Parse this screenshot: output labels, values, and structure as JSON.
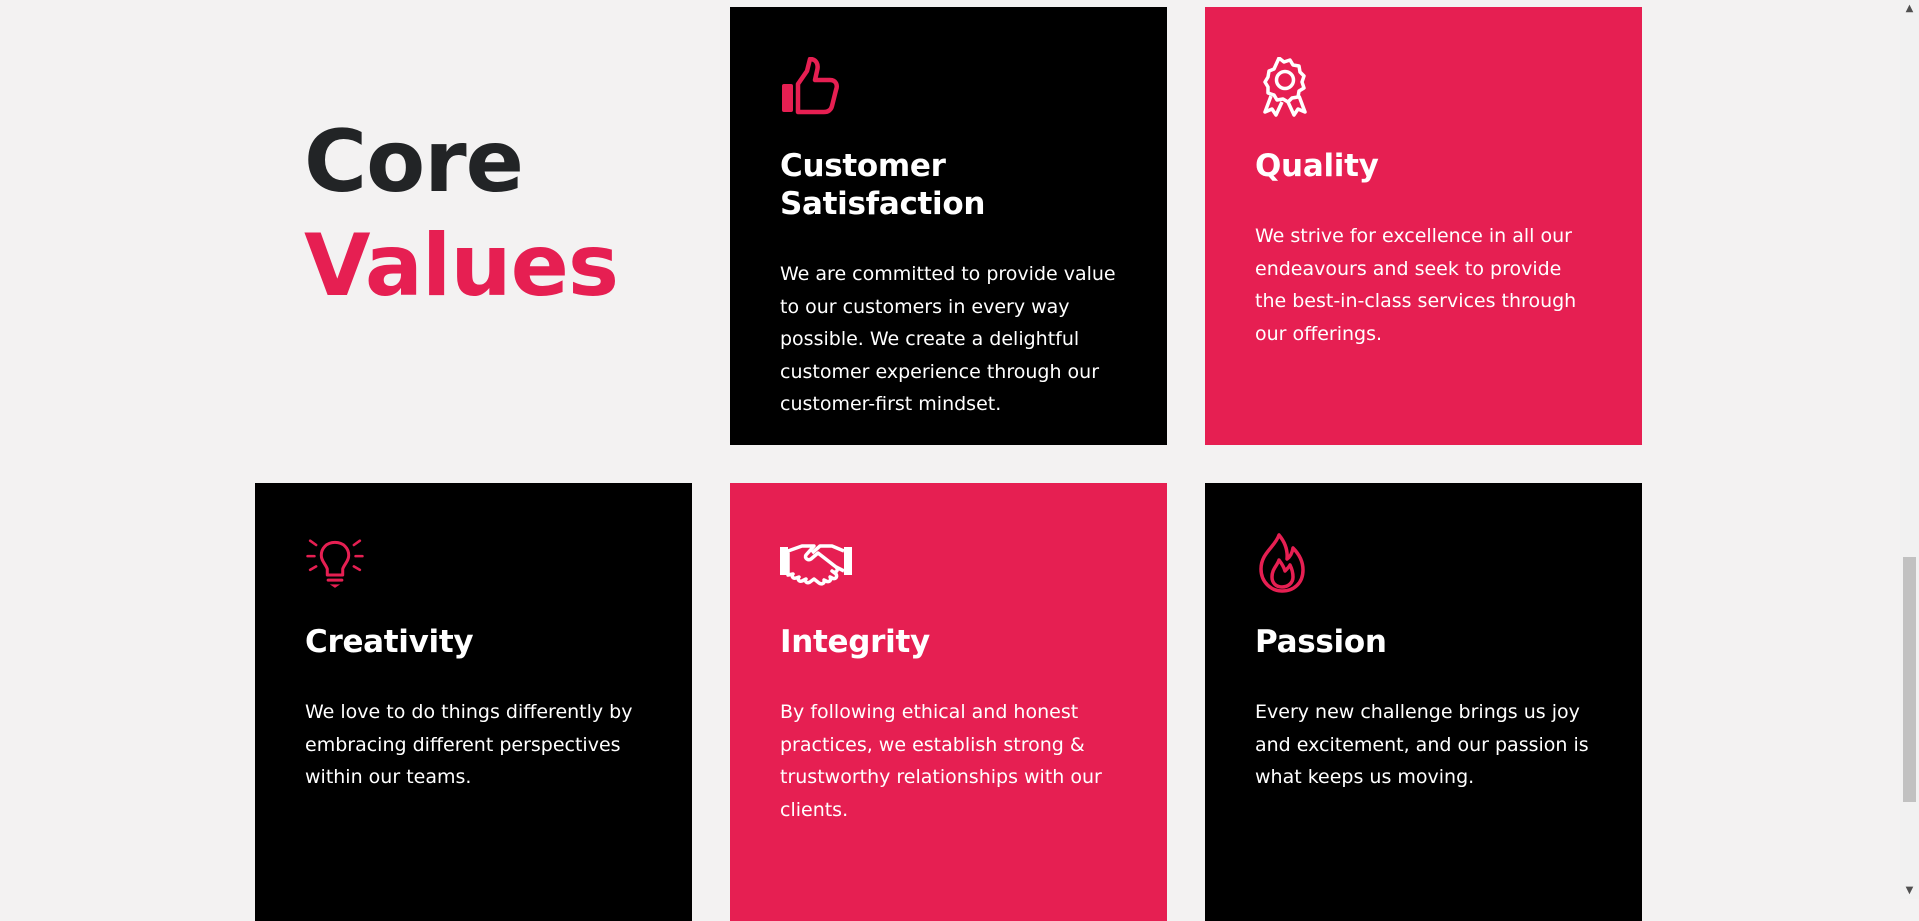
{
  "heading": {
    "line1": "Core",
    "line2": "Values"
  },
  "colors": {
    "accent": "#e61f52",
    "dark": "#000000",
    "background": "#f3f2f2",
    "heading_dark": "#222426"
  },
  "cards": [
    {
      "title": "Customer Satisfaction",
      "icon": "thumbs-up-icon",
      "theme": "black",
      "text": "We are committed to provide value to our customers in every way possible. We create a delightful customer experience through our customer-first mindset."
    },
    {
      "title": "Quality",
      "icon": "award-ribbon-icon",
      "theme": "pink",
      "text": "We strive for excellence in all our endeavours and seek to provide the best-in-class services through our offerings."
    },
    {
      "title": "Creativity",
      "icon": "lightbulb-icon",
      "theme": "black",
      "text": "We love to do things differently by embracing different perspectives within our teams."
    },
    {
      "title": "Integrity",
      "icon": "handshake-icon",
      "theme": "pink",
      "text": "By following ethical and honest practices, we establish strong & trustworthy relationships with our clients."
    },
    {
      "title": "Passion",
      "icon": "flame-icon",
      "theme": "black",
      "text": "Every new challenge brings us joy and excitement, and our passion is what keeps us moving."
    }
  ]
}
